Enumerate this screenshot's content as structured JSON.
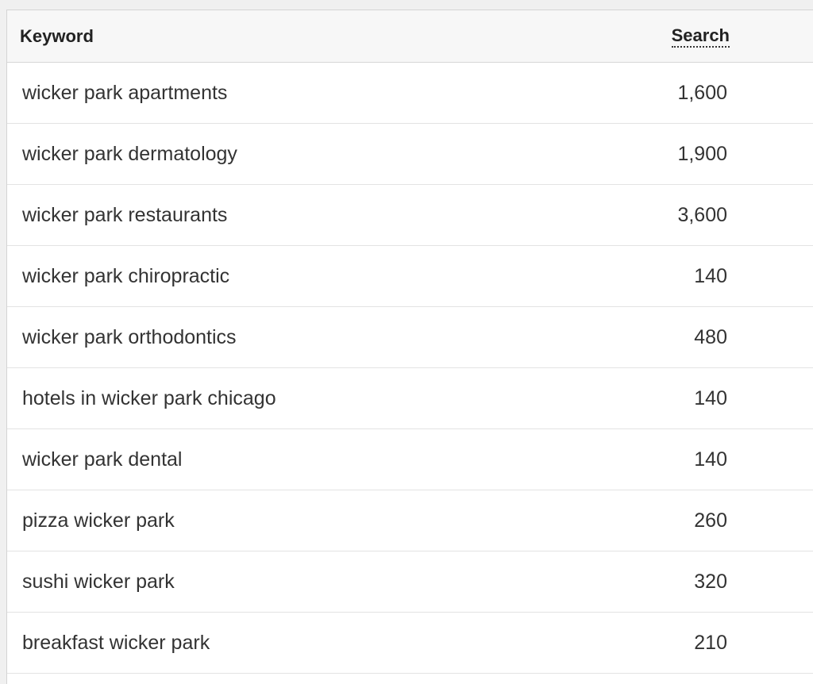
{
  "table": {
    "headers": {
      "keyword": "Keyword",
      "search": "Search"
    },
    "rows": [
      {
        "keyword": "wicker park apartments",
        "search": "1,600"
      },
      {
        "keyword": "wicker park dermatology",
        "search": "1,900"
      },
      {
        "keyword": "wicker park restaurants",
        "search": "3,600"
      },
      {
        "keyword": "wicker park chiropractic",
        "search": "140"
      },
      {
        "keyword": "wicker park orthodontics",
        "search": "480"
      },
      {
        "keyword": "hotels in wicker park chicago",
        "search": "140"
      },
      {
        "keyword": "wicker park dental",
        "search": "140"
      },
      {
        "keyword": "pizza wicker park",
        "search": "260"
      },
      {
        "keyword": "sushi wicker park",
        "search": "320"
      },
      {
        "keyword": "breakfast wicker park",
        "search": "210"
      }
    ]
  }
}
